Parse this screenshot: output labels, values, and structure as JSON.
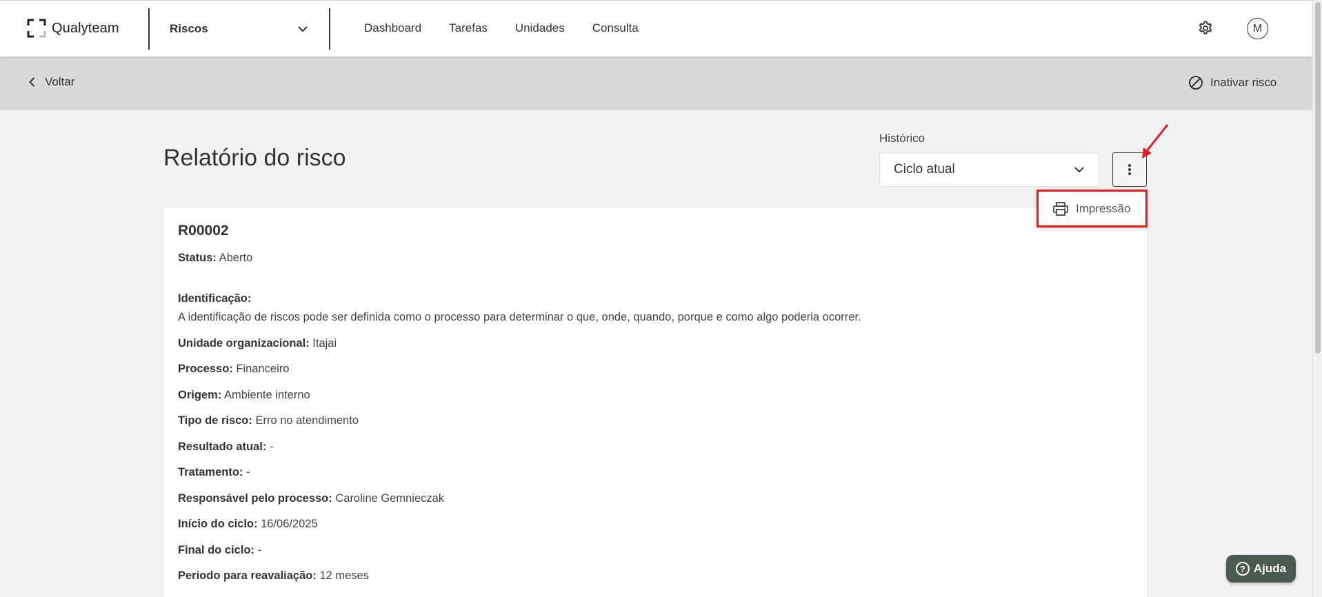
{
  "header": {
    "logo_text": "Qualyteam",
    "module_select": "Riscos",
    "nav": [
      "Dashboard",
      "Tarefas",
      "Unidades",
      "Consulta"
    ],
    "avatar_initial": "M"
  },
  "actionbar": {
    "back_label": "Voltar",
    "inactivate_label": "Inativar risco"
  },
  "page": {
    "title": "Relatório do risco",
    "history_label": "Histórico",
    "history_value": "Ciclo atual"
  },
  "menu": {
    "print_label": "Impressão"
  },
  "report": {
    "code": "R00002",
    "status_label": "Status:",
    "status_value": "Aberto",
    "identification_label": "Identificação:",
    "identification_text": "A identificação de riscos pode ser definida como o processo para determinar o que, onde, quando, porque e como algo poderia ocorrer.",
    "fields": [
      {
        "label": "Unidade organizacional:",
        "value": "Itajai"
      },
      {
        "label": "Processo:",
        "value": "Financeiro"
      },
      {
        "label": "Origem:",
        "value": "Ambiente interno"
      },
      {
        "label": "Tipo de risco:",
        "value": "Erro no atendimento"
      },
      {
        "label": "Resultado atual:",
        "value": "-"
      },
      {
        "label": "Tratamento:",
        "value": "-"
      },
      {
        "label": "Responsável pelo processo:",
        "value": "Caroline Gemnieczak"
      },
      {
        "label": "Início do ciclo:",
        "value": "16/06/2025"
      },
      {
        "label": "Final do ciclo:",
        "value": "-"
      },
      {
        "label": "Periodo para reavaliação:",
        "value": "12 meses"
      }
    ]
  },
  "help": {
    "icon_glyph": "?",
    "label": "Ajuda"
  },
  "colors": {
    "highlight": "#e11b1b",
    "help_button": "#4a5a4e",
    "action_bar": "#d9d9d9"
  }
}
